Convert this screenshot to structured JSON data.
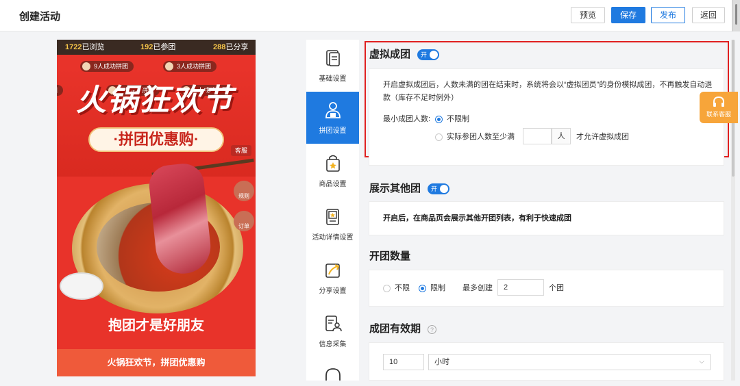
{
  "header": {
    "title": "创建活动",
    "buttons": {
      "preview": "预览",
      "save": "保存",
      "publish": "发布",
      "back": "返回"
    }
  },
  "phone": {
    "stats": {
      "views_num": "1722",
      "views_label": "已浏览",
      "joined_num": "192",
      "joined_label": "已参团",
      "shared_num": "288",
      "shared_label": "已分享"
    },
    "ticker": [
      "9人成功拼团",
      "3人成功拼团",
      "1人成功拼团",
      "4人成功拼团",
      "团"
    ],
    "banner_title": "火锅狂欢节",
    "subtitle": "·拼团优惠购·",
    "cs_tag": "客服",
    "rule_btn": "规则",
    "order_btn": "订单",
    "slogan": "抱团才是好朋友",
    "bottom_bar": "火锅狂欢节，拼团优惠购"
  },
  "tabs": [
    {
      "label": "基础设置",
      "icon": "document-icon",
      "active": false
    },
    {
      "label": "拼团设置",
      "icon": "group-users-icon",
      "active": true
    },
    {
      "label": "商品设置",
      "icon": "shopping-bag-icon",
      "active": false
    },
    {
      "label": "活动详情设置",
      "icon": "detail-star-icon",
      "active": false
    },
    {
      "label": "分享设置",
      "icon": "share-arrow-icon",
      "active": false
    },
    {
      "label": "信息采集",
      "icon": "form-user-icon",
      "active": false
    }
  ],
  "virtual_group": {
    "title": "虚拟成团",
    "toggle": "开",
    "desc": "开启虚拟成团后，人数未满的团在结束时，系统将会以“虚拟团员”的身份模拟成团，不再触发自动退款（库存不足时例外）",
    "min_label": "最小成团人数:",
    "opt_unlimited": "不限制",
    "opt_actual": "实际参团人数至少满",
    "unit": "人",
    "suffix": "才允许虚拟成团"
  },
  "show_other": {
    "title": "展示其他团",
    "toggle": "开",
    "desc": "开启后，在商品页会展示其他开团列表，有利于快速成团"
  },
  "group_count": {
    "title": "开团数量",
    "opt_unlimited": "不限",
    "opt_limited": "限制",
    "max_label": "最多创建",
    "value": "2",
    "unit": "个团"
  },
  "validity": {
    "title": "成团有效期",
    "help": "?",
    "value": "10",
    "unit_select": "小时"
  },
  "contact": {
    "label": "联系客服"
  },
  "colors": {
    "primary": "#1f7ae0",
    "highlight": "#e02020",
    "poster_red": "#e8332a"
  }
}
